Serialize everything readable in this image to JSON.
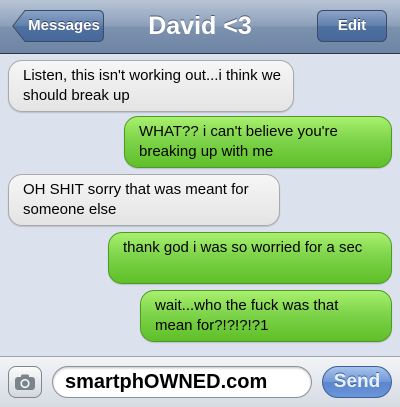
{
  "header": {
    "back_label": "Messages",
    "title": "David <3",
    "edit_label": "Edit"
  },
  "messages": [
    {
      "direction": "incoming",
      "text": "Listen, this isn't working out...i think we should break up"
    },
    {
      "direction": "outgoing",
      "text": "WHAT?? i can't believe you're breaking up with me"
    },
    {
      "direction": "incoming",
      "text": "OH SHIT sorry that was meant for someone else"
    },
    {
      "direction": "outgoing",
      "text": "thank god i was so worried for a sec"
    },
    {
      "direction": "outgoing",
      "text": "wait...who the fuck was that mean for?!?!?!?1"
    }
  ],
  "compose": {
    "camera_icon": "camera-icon",
    "input_value": "smartphOWNED.com",
    "send_label": "Send"
  },
  "colors": {
    "incoming_bubble": "#e9e9e9",
    "outgoing_bubble": "#7ed44a",
    "navbar": "#8da0ba",
    "send_button": "#6f96d6"
  }
}
